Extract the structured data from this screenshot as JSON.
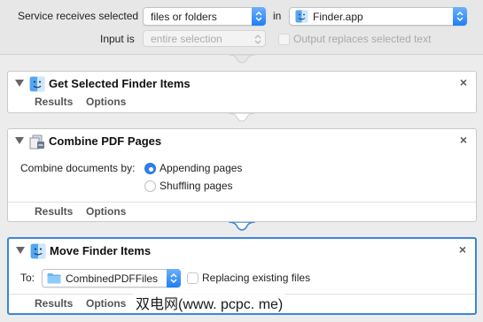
{
  "header": {
    "service_label": "Service receives selected",
    "input_type": "files or folders",
    "in_label": "in",
    "app": "Finder.app",
    "input_is_label": "Input is",
    "input_is_value": "entire selection",
    "output_replaces_label": "Output replaces selected text"
  },
  "actions": [
    {
      "title": "Get Selected Finder Items",
      "tabs": [
        "Results",
        "Options"
      ]
    },
    {
      "title": "Combine PDF Pages",
      "combine_label": "Combine documents by:",
      "options": [
        "Appending pages",
        "Shuffling pages"
      ],
      "selected": "Appending pages",
      "tabs": [
        "Results",
        "Options"
      ]
    },
    {
      "title": "Move Finder Items",
      "to_label": "To:",
      "folder": "CombinedPDFFiles",
      "replacing_label": "Replacing existing files",
      "tabs": [
        "Results",
        "Options"
      ]
    }
  ],
  "watermark": "双电网(www. pcpc. me)",
  "colors": {
    "accent": "#2f80ed",
    "selected_border": "#3b86d8"
  }
}
